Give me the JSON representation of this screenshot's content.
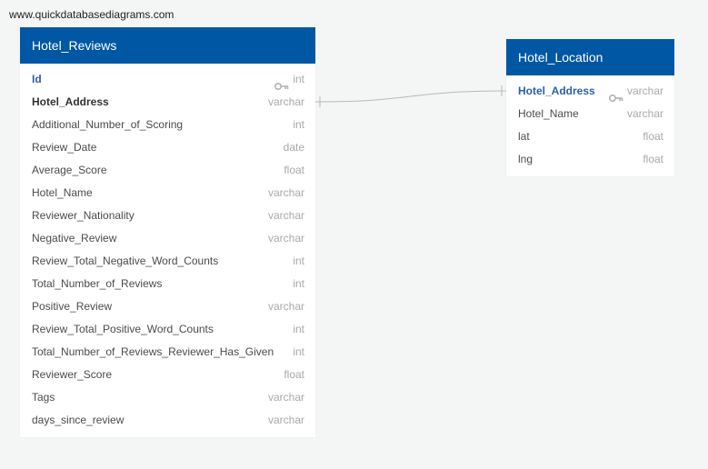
{
  "watermark": "www.quickdatabasediagrams.com",
  "colors": {
    "header_bg": "#0057a4",
    "header_text": "#ffffff",
    "pk_text": "#2b5fa8",
    "type_text": "#a9a9a9",
    "background": "#f4f5f5",
    "connector": "#b8b8b8"
  },
  "tables": {
    "hotel_reviews": {
      "title": "Hotel_Reviews",
      "columns": [
        {
          "name": "Id",
          "type": "int",
          "pk": true
        },
        {
          "name": "Hotel_Address",
          "type": "varchar",
          "fk": true
        },
        {
          "name": "Additional_Number_of_Scoring",
          "type": "int"
        },
        {
          "name": "Review_Date",
          "type": "date"
        },
        {
          "name": "Average_Score",
          "type": "float"
        },
        {
          "name": "Hotel_Name",
          "type": "varchar"
        },
        {
          "name": "Reviewer_Nationality",
          "type": "varchar"
        },
        {
          "name": "Negative_Review",
          "type": "varchar"
        },
        {
          "name": "Review_Total_Negative_Word_Counts",
          "type": "int"
        },
        {
          "name": "Total_Number_of_Reviews",
          "type": "int"
        },
        {
          "name": "Positive_Review",
          "type": "varchar"
        },
        {
          "name": "Review_Total_Positive_Word_Counts",
          "type": "int"
        },
        {
          "name": "Total_Number_of_Reviews_Reviewer_Has_Given",
          "type": "int"
        },
        {
          "name": "Reviewer_Score",
          "type": "float"
        },
        {
          "name": "Tags",
          "type": "varchar"
        },
        {
          "name": "days_since_review",
          "type": "varchar"
        }
      ]
    },
    "hotel_location": {
      "title": "Hotel_Location",
      "columns": [
        {
          "name": "Hotel_Address",
          "type": "varchar",
          "pk": true
        },
        {
          "name": "Hotel_Name",
          "type": "varchar"
        },
        {
          "name": "lat",
          "type": "float"
        },
        {
          "name": "lng",
          "type": "float"
        }
      ]
    }
  },
  "relationship": {
    "from": "Hotel_Reviews.Hotel_Address",
    "to": "Hotel_Location.Hotel_Address",
    "icon": "one-to-one-connector-icon"
  }
}
